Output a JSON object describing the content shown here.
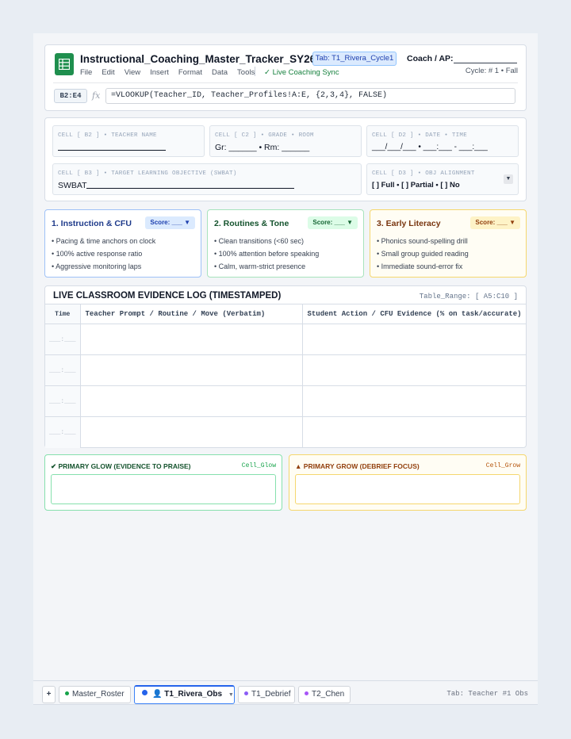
{
  "header": {
    "doc_title": "Instructional_Coaching_Master_Tracker_SY26-27",
    "tab_badge": "Tab: T1_Rivera_Cycle1",
    "coach_label": "Coach / AP:",
    "menu": [
      "File",
      "Edit",
      "View",
      "Insert",
      "Format",
      "Data",
      "Tools"
    ],
    "sync_status": "✓ Live Coaching Sync",
    "cycle": "Cycle: # 1 • Fall",
    "cell_ref": "B2:E4",
    "fx": "fx",
    "formula": "=VLOOKUP(Teacher_ID, Teacher_Profiles!A:E, {2,3,4}, FALSE)"
  },
  "info": {
    "b2_label": "CELL [ B2 ] • TEACHER NAME",
    "c2_label": "CELL [ C2 ] • GRADE • ROOM",
    "c2_value": "Gr: ______ • Rm: ______",
    "d2_label": "CELL [ D2 ] • DATE • TIME",
    "d2_value": "___/___/___ • ___:___ - ___:___",
    "b3_label": "CELL [ B3 ] • TARGET LEARNING OBJECTIVE (SWBAT)",
    "b3_value": "SWBAT",
    "d3_label": "CELL [ D3 ] • OBJ ALIGNMENT",
    "d3_value": "[ ] Full • [ ] Partial • [ ] No"
  },
  "domains": [
    {
      "title": "1. Instruction & CFU",
      "score": "Score: ___ ▼",
      "items": [
        "Pacing & time anchors on clock",
        "100% active response ratio",
        "Aggressive monitoring laps"
      ]
    },
    {
      "title": "2. Routines & Tone",
      "score": "Score: ___ ▼",
      "items": [
        "Clean transitions (<60 sec)",
        "100% attention before speaking",
        "Calm, warm-strict presence"
      ]
    },
    {
      "title": "3. Early Literacy",
      "score": "Score: ___ ▼",
      "items": [
        "Phonics sound-spelling drill",
        "Small group guided reading",
        "Immediate sound-error fix"
      ]
    }
  ],
  "log": {
    "title": "LIVE CLASSROOM EVIDENCE LOG (TIMESTAMPED)",
    "range": "Table_Range: [ A5:C10 ]",
    "columns": [
      "Time",
      "Teacher Prompt / Routine / Move (Verbatim)",
      "Student Action / CFU Evidence (% on task/accurate)"
    ],
    "time_placeholder": "___:___"
  },
  "glow": {
    "title": "✔ PRIMARY GLOW (EVIDENCE TO PRAISE)",
    "cell": "Cell_Glow"
  },
  "grow": {
    "title": "▲ PRIMARY GROW (DEBRIEF FOCUS)",
    "cell": "Cell_Grow"
  },
  "tabs": {
    "add": "+",
    "items": [
      "Master_Roster",
      "👤 T1_Rivera_Obs",
      "T1_Debrief",
      "T2_Chen"
    ],
    "active_arrow": "▼",
    "caption": "Tab: Teacher #1 Obs"
  },
  "colors": {
    "brand_green": "#1f8f4e",
    "domain1": "#2563eb",
    "domain2": "#16a34a",
    "domain3": "#eab308",
    "active_tab": "#2563eb"
  }
}
